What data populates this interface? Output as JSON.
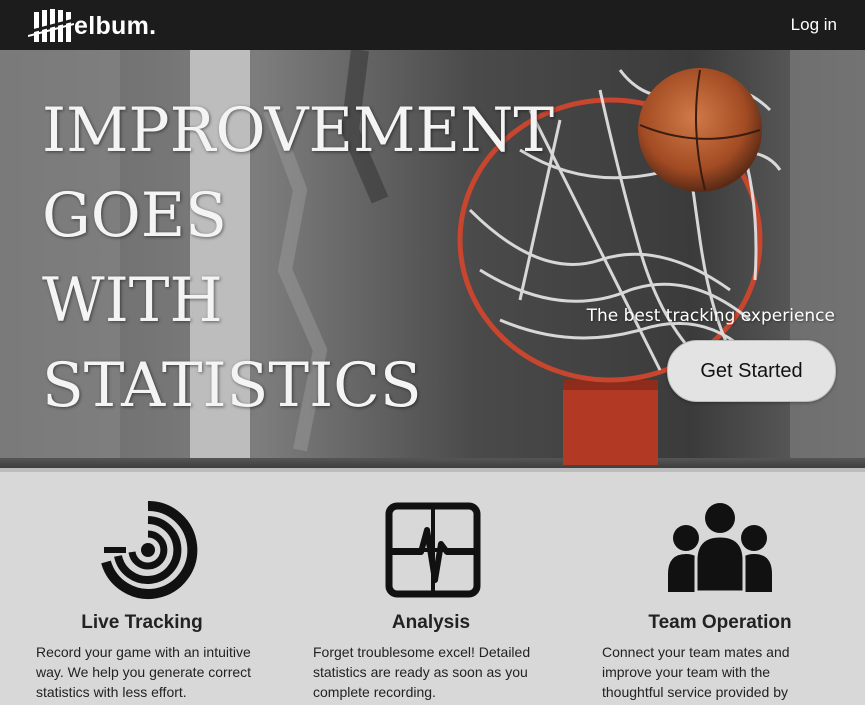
{
  "brand": {
    "name": "elbum."
  },
  "nav": {
    "login_label": "Log in"
  },
  "hero": {
    "headline_lines": [
      "IMPROVEMENT",
      "GOES",
      "WITH",
      "STATISTICS"
    ],
    "tagline": "The best tracking experience",
    "cta_label": "Get Started"
  },
  "features": [
    {
      "icon": "live-tracking-radar-icon",
      "title": "Live Tracking",
      "lines": [
        "Record your game with an intuitive",
        "way. We help you generate correct",
        "statistics with less effort."
      ]
    },
    {
      "icon": "analysis-pulse-chart-icon",
      "title": "Analysis",
      "lines": [
        "Forget troublesome excel! Detailed",
        "statistics are ready as soon as you",
        "complete recording."
      ]
    },
    {
      "icon": "team-people-icon",
      "title": "Team Operation",
      "lines": [
        "Connect your team mates and",
        "improve your team with the",
        "thoughtful service provided by"
      ]
    }
  ],
  "colors": {
    "navbar": "#1c1c1c",
    "features_bg": "#d8d8d8",
    "rim": "#c8452e",
    "ball": "#b85a2e"
  }
}
